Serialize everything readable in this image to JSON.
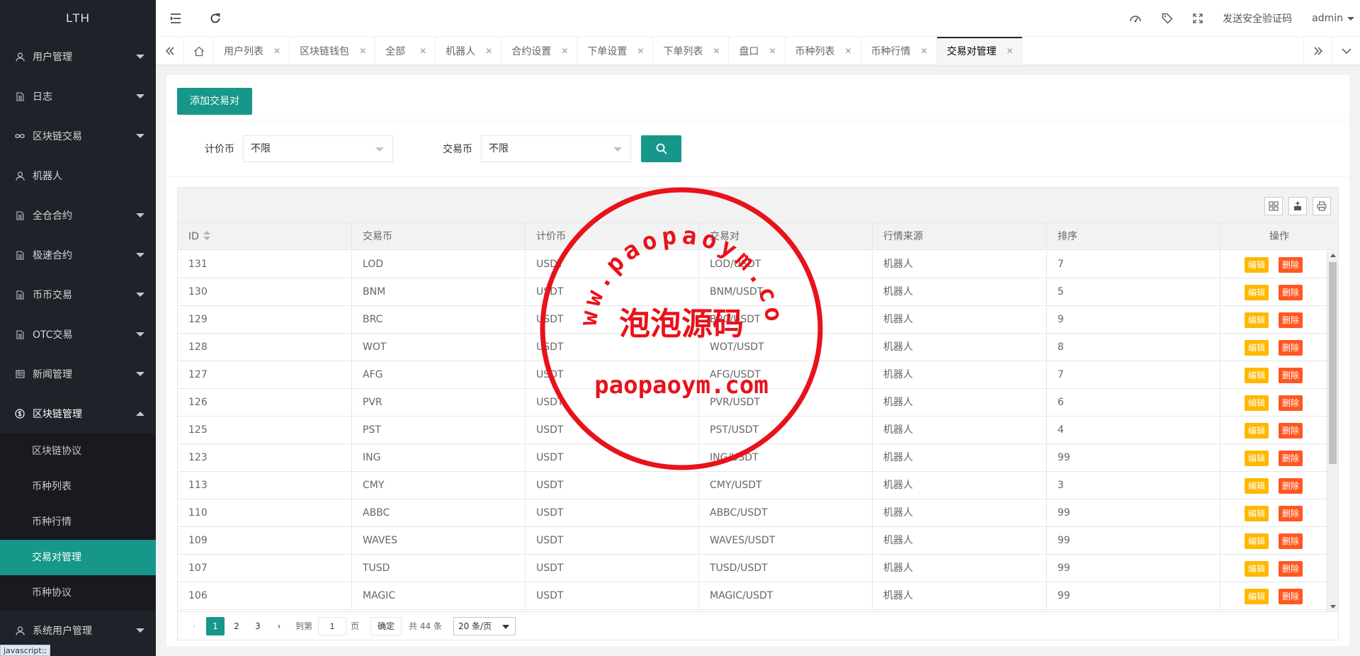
{
  "app": {
    "logo": "LTH"
  },
  "sidebar": {
    "items": [
      {
        "label": "用户管理",
        "icon": "user-icon"
      },
      {
        "label": "日志",
        "icon": "file-icon"
      },
      {
        "label": "区块链交易",
        "icon": "infinity-icon"
      },
      {
        "label": "机器人",
        "icon": "user-icon"
      },
      {
        "label": "全仓合约",
        "icon": "file-icon"
      },
      {
        "label": "极速合约",
        "icon": "file-icon"
      },
      {
        "label": "币币交易",
        "icon": "file-icon"
      },
      {
        "label": "OTC交易",
        "icon": "file-icon"
      },
      {
        "label": "新闻管理",
        "icon": "news-icon"
      },
      {
        "label": "区块链管理",
        "icon": "dollar-icon"
      }
    ],
    "sub_items": [
      "区块链协议",
      "币种列表",
      "币种行情",
      "交易对管理",
      "币种协议"
    ],
    "after": {
      "label": "系统用户管理",
      "icon": "user-icon"
    },
    "status_tip": "javascript:;"
  },
  "header": {
    "security_code": "发送安全验证码",
    "user": "admin"
  },
  "tabs": [
    "用户列表",
    "区块链钱包",
    "全部",
    "机器人",
    "合约设置",
    "下单设置",
    "下单列表",
    "盘口",
    "币种列表",
    "币种行情",
    "交易对管理"
  ],
  "page": {
    "add_button": "添加交易对",
    "filter": {
      "quote_label": "计价币",
      "quote_value": "不限",
      "base_label": "交易币",
      "base_value": "不限"
    }
  },
  "table": {
    "headers": [
      "ID",
      "交易币",
      "计价币",
      "交易对",
      "行情来源",
      "排序",
      "操作"
    ],
    "edit_label": "编辑",
    "delete_label": "删除",
    "rows": [
      [
        "131",
        "LOD",
        "USDT",
        "LOD/USDT",
        "机器人",
        "7"
      ],
      [
        "130",
        "BNM",
        "USDT",
        "BNM/USDT",
        "机器人",
        "5"
      ],
      [
        "129",
        "BRC",
        "USDT",
        "BRC/USDT",
        "机器人",
        "9"
      ],
      [
        "128",
        "WOT",
        "USDT",
        "WOT/USDT",
        "机器人",
        "8"
      ],
      [
        "127",
        "AFG",
        "USDT",
        "AFG/USDT",
        "机器人",
        "7"
      ],
      [
        "126",
        "PVR",
        "USDT",
        "PVR/USDT",
        "机器人",
        "6"
      ],
      [
        "125",
        "PST",
        "USDT",
        "PST/USDT",
        "机器人",
        "4"
      ],
      [
        "123",
        "ING",
        "USDT",
        "ING/USDT",
        "机器人",
        "99"
      ],
      [
        "113",
        "CMY",
        "USDT",
        "CMY/USDT",
        "机器人",
        "3"
      ],
      [
        "110",
        "ABBC",
        "USDT",
        "ABBC/USDT",
        "机器人",
        "99"
      ],
      [
        "109",
        "WAVES",
        "USDT",
        "WAVES/USDT",
        "机器人",
        "99"
      ],
      [
        "107",
        "TUSD",
        "USDT",
        "TUSD/USDT",
        "机器人",
        "99"
      ],
      [
        "106",
        "MAGIC",
        "USDT",
        "MAGIC/USDT",
        "机器人",
        "99"
      ]
    ]
  },
  "pager": {
    "pages": [
      "1",
      "2",
      "3"
    ],
    "goto_label": "到第",
    "goto_value": "1",
    "page_unit": "页",
    "confirm": "确定",
    "total": "共 44 条",
    "page_size": "20 条/页"
  },
  "watermark": {
    "arc_text": "www.paopaoym.com",
    "center_text": "泡泡源码",
    "bottom_text": "paopaoym.com"
  }
}
